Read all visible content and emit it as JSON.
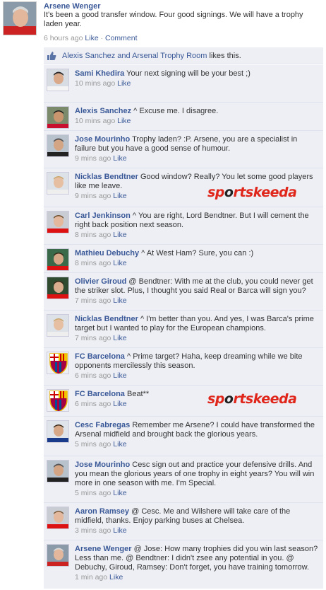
{
  "post": {
    "author": "Arsene Wenger",
    "text": "It's been a good transfer window. Four good signings. We will have a trophy laden year.",
    "time": "6 hours ago",
    "like_label": "Like",
    "comment_label": "Comment",
    "separator": "·"
  },
  "likes": {
    "users": "Alexis Sanchez and Arsenal Trophy Room",
    "suffix": "likes this."
  },
  "comments": [
    {
      "name": "Sami Khedira",
      "text": "Your next signing will be your best ;)",
      "time": "10 mins ago",
      "like": "Like"
    },
    {
      "name": "Alexis Sanchez",
      "text": "^ Excuse me. I disagree.",
      "time": "10 mins ago",
      "like": "Like"
    },
    {
      "name": "Jose Mourinho",
      "text": "Trophy laden? :P. Arsene, you are a specialist in failure but you have a good sense of humour.",
      "time": "9 mins ago",
      "like": "Like"
    },
    {
      "name": "Nicklas Bendtner",
      "text": "Good window? Really? You let some good players like me leave.",
      "time": "9 mins ago",
      "like": "Like"
    },
    {
      "name": "Carl Jenkinson",
      "text": "^ You are right, Lord Bendtner. But I will cement the right back position next season.",
      "time": "8 mins ago",
      "like": "Like"
    },
    {
      "name": "Mathieu Debuchy",
      "text": "^ At West Ham? Sure, you can :)",
      "time": "8 mins ago",
      "like": "Like"
    },
    {
      "name": "Olivier Giroud",
      "text": "@ Bendtner: With me at the club, you could never get the striker slot. Plus, I thought you said Real or Barca will sign you?",
      "time": "7 mins ago",
      "like": "Like"
    },
    {
      "name": "Nicklas Bendtner",
      "text": "^ I'm better than you. And yes, I was Barca's prime target but I wanted to play for the European champions.",
      "time": "7 mins ago",
      "like": "Like"
    },
    {
      "name": "FC Barcelona",
      "text": "^ Prime target? Haha, keep dreaming while we bite opponents mercilessly this season.",
      "time": "6 mins ago",
      "like": "Like"
    },
    {
      "name": "FC Barcelona",
      "text": "Beat**",
      "time": "6 mins ago",
      "like": "Like"
    },
    {
      "name": "Cesc Fabregas",
      "text": "Remember me Arsene? I could have transformed the Arsenal midfield and brought back the glorious years.",
      "time": "5 mins ago",
      "like": "Like"
    },
    {
      "name": "Jose Mourinho",
      "text": "Cesc sign out and practice your defensive drills. And you mean the glorious years of one trophy in eight years? You will win more in one season with me. I'm Special.",
      "time": "5 mins ago",
      "like": "Like"
    },
    {
      "name": "Aaron Ramsey",
      "text": "@ Cesc. Me and Wilshere will take care of the midfield, thanks. Enjoy parking buses at Chelsea.",
      "time": "3 mins ago",
      "like": "Like"
    },
    {
      "name": "Arsene Wenger",
      "text": "@ Jose: How many trophies did you win last season? Less than me. @ Bendtner: I didn't zsee any potential in you. @ Debuchy, Giroud, Ramsey: Don't forget, you have training tomorrow.",
      "time": "1 min ago",
      "like": "Like"
    }
  ],
  "watermark": {
    "brand": "sportskeeda",
    "prefix": "sp",
    "o": "o",
    "suffix": "rtskeeda",
    "color_red": "#e0261b",
    "color_dark": "#222222"
  },
  "colors": {
    "link": "#3b5998",
    "comment_bg": "#edeff4",
    "meta": "#999999"
  }
}
